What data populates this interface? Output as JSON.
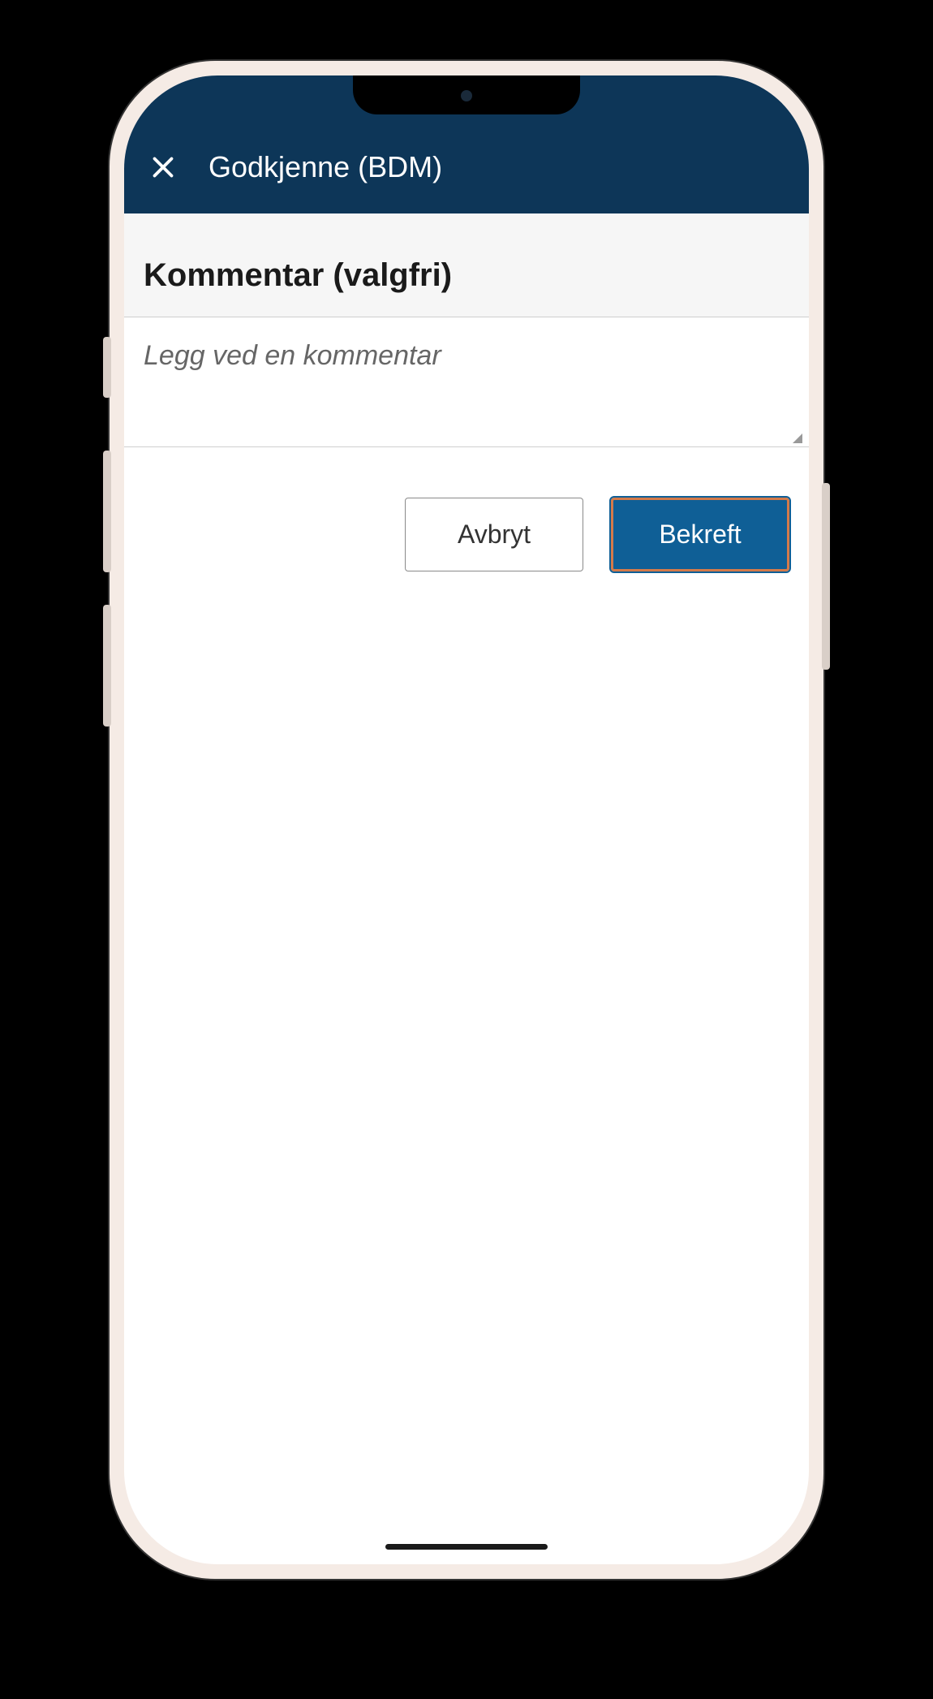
{
  "header": {
    "title": "Godkjenne (BDM)"
  },
  "section": {
    "title": "Kommentar (valgfri)"
  },
  "comment": {
    "placeholder": "Legg ved en kommentar",
    "value": ""
  },
  "buttons": {
    "cancel_label": "Avbryt",
    "confirm_label": "Bekreft"
  },
  "colors": {
    "header_bg": "#0d3658",
    "primary_button": "#0f5f96",
    "highlight_border": "#d47a4a"
  }
}
